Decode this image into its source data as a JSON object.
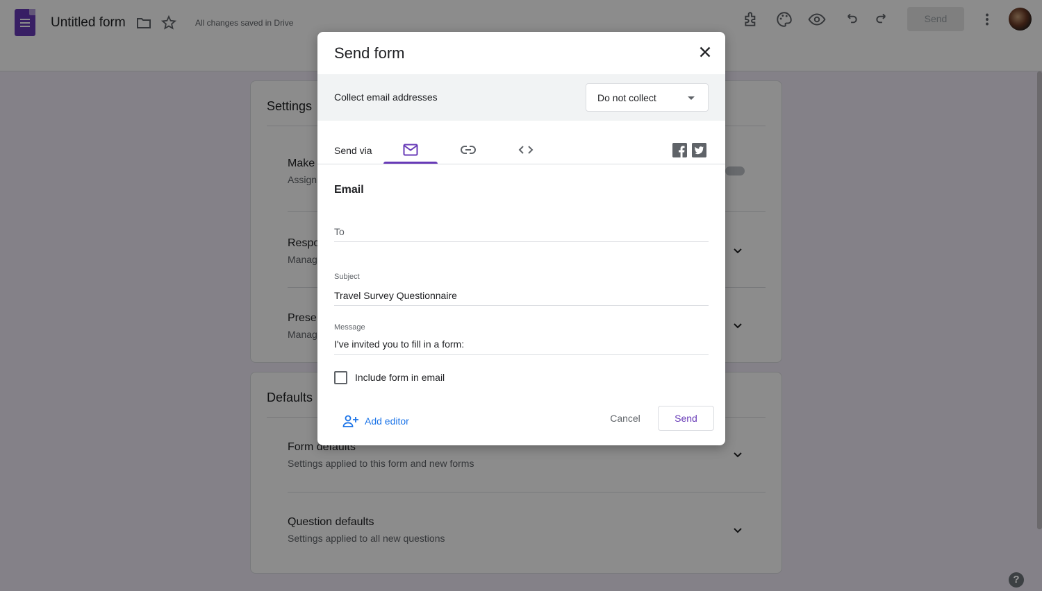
{
  "app": {
    "form_title": "Untitled form",
    "saved_status": "All changes saved in Drive",
    "send_button": "Send",
    "brand_color": "#673ab7"
  },
  "toolbar_icons": [
    "addon-icon",
    "palette-icon",
    "preview-eye-icon",
    "undo-icon",
    "redo-icon",
    "more-vert-icon"
  ],
  "settings": {
    "heading": "Settings",
    "rows": [
      {
        "title": "Make",
        "subtitle": "Assign"
      },
      {
        "title": "Respo",
        "subtitle": "Manag"
      },
      {
        "title": "Prese",
        "subtitle": "Manag"
      }
    ]
  },
  "defaults": {
    "heading": "Defaults",
    "rows": [
      {
        "title": "Form defaults",
        "subtitle": "Settings applied to this form and new forms"
      },
      {
        "title": "Question defaults",
        "subtitle": "Settings applied to all new questions"
      }
    ]
  },
  "dialog": {
    "title": "Send form",
    "collect_label": "Collect email addresses",
    "collect_value": "Do not collect",
    "send_via_label": "Send via",
    "tabs": [
      "email-icon",
      "link-icon",
      "embed-code-icon"
    ],
    "active_tab": "email-icon",
    "section_heading": "Email",
    "to_placeholder": "To",
    "subject_label": "Subject",
    "subject_value": "Travel Survey Questionnaire",
    "message_label": "Message",
    "message_value": "I've invited you to fill in a form:",
    "include_form_label": "Include form in email",
    "include_form_checked": false,
    "add_editor_label": "Add editor",
    "cancel_label": "Cancel",
    "send_label": "Send"
  },
  "help_glyph": "?"
}
